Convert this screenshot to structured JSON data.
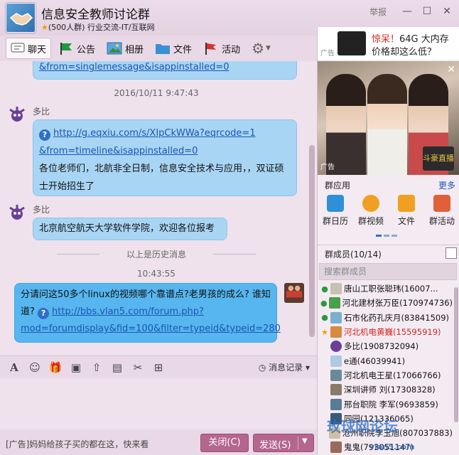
{
  "window": {
    "group_name": "信息安全教师讨论群",
    "group_meta": "(500人群) 行业交流-IT/互联网",
    "report": "举报"
  },
  "toolbar": {
    "chat": "聊天",
    "notice": "公告",
    "album": "相册",
    "file": "文件",
    "activity": "活动"
  },
  "chat": {
    "msg0_tail": "&from=singlemessage&isappinstalled=0",
    "time1": "2016/10/11 9:47:43",
    "msg1": {
      "sender": "多比",
      "link1": "http://g.eqxiu.com/s/XIpCkWWa?eqrcode=1",
      "link2": "&from=timeline&isappinstalled=0",
      "text1": "各位老师们，北航非全日制，信息安全技术与应用，，双证硕",
      "text2": "士开始招生了"
    },
    "msg2": {
      "sender": "多比",
      "text": "北京航空航天大学软件学院，欢迎各位报考"
    },
    "history_divider": "以上是历史消息",
    "time2": "10:43:55",
    "msg3": {
      "text1": "分请问这50多个linux的视频哪个靠谱点?老男孩的成么? 谁知",
      "text2_prefix": "道?",
      "link1": "http://bbs.vlan5.com/forum.php?",
      "link2": "mod=forumdisplay&fid=100&filter=typeid&typeid=280"
    }
  },
  "input": {
    "msg_record": "消息记录"
  },
  "bottom": {
    "ad": "[广告]妈妈给孩子买的都在这，快来看",
    "close": "关闭(C)",
    "send": "发送(S)"
  },
  "ads": {
    "banner_tag": "广告",
    "banner_line1_red": "惊呆！",
    "banner_line1": "64G 大内存",
    "banner_line2": "价格却这么低？",
    "photo_tag": "广告",
    "photo_logo": "斗豪直播"
  },
  "apps": {
    "title": "群应用",
    "more": "更多",
    "items": [
      "群日历",
      "群视频",
      "文件",
      "群活动"
    ]
  },
  "members": {
    "title": "群成员(10/14)",
    "search_placeholder": "搜索群成员",
    "list": [
      "唐山工职张聪玮(16007...",
      "河北建材张万臣(170974736)",
      "石市化药孔庆月(83841509)",
      "河北机电黄巍(15595919)",
      "多比(1908732094)",
      "e通(46039941)",
      "河北机电王星(17066766)",
      "深圳讲师 刘(17308328)",
      "邢台职院 李军(9693859)",
      "同园(121336065)",
      "沧州职院李玉旭(807037883)",
      "鬼鬼(793051147)"
    ]
  },
  "watermark": {
    "text": "玫球网论坛",
    "sub": "vlan5.com"
  },
  "colors": {
    "chrome": "#e9d9e6",
    "bubble_other": "#a9d5f4",
    "bubble_mine": "#57b6ef",
    "button": "#b4668f",
    "owner_name": "#d2251f"
  }
}
